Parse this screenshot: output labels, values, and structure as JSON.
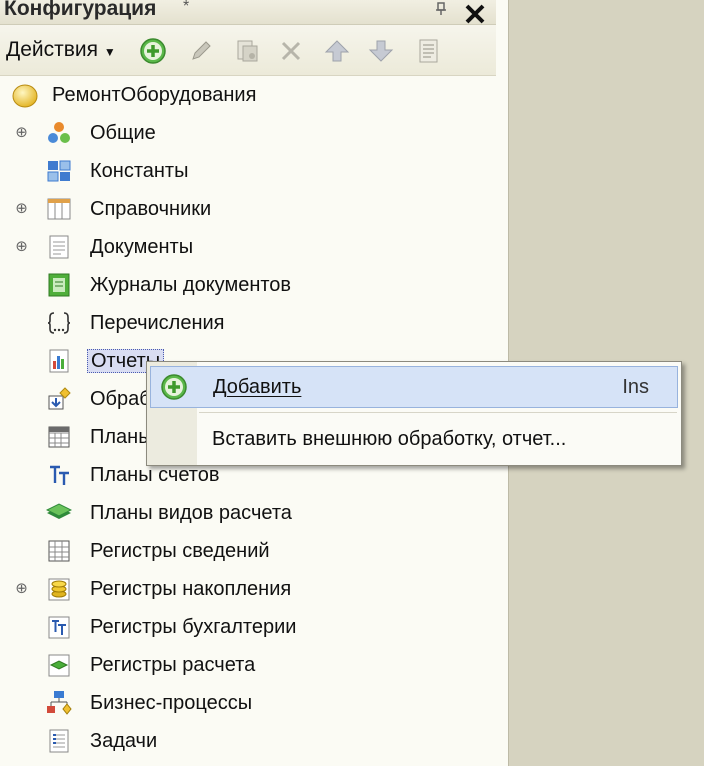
{
  "window": {
    "title": "Конфигурация",
    "title_marker": "*",
    "pin_symbol": "ª",
    "close_symbol": "✕"
  },
  "toolbar": {
    "actions_label": "Действия",
    "buttons": [
      {
        "name": "add-button",
        "icon": "plus-circle-icon"
      },
      {
        "name": "edit-button",
        "icon": "pencil-icon"
      },
      {
        "name": "copy-button",
        "icon": "copy-icon"
      },
      {
        "name": "delete-button",
        "icon": "x-icon"
      },
      {
        "name": "move-up-button",
        "icon": "arrow-up-icon"
      },
      {
        "name": "move-down-button",
        "icon": "arrow-down-icon"
      },
      {
        "name": "properties-button",
        "icon": "list-icon"
      }
    ]
  },
  "tree": {
    "items": [
      {
        "label": "РемонтОборудования",
        "icon": "root-config-icon",
        "expandable": false
      },
      {
        "label": "Общие",
        "icon": "common-icon",
        "expandable": true
      },
      {
        "label": "Константы",
        "icon": "constants-icon",
        "expandable": false
      },
      {
        "label": "Справочники",
        "icon": "catalogs-icon",
        "expandable": true
      },
      {
        "label": "Документы",
        "icon": "documents-icon",
        "expandable": true
      },
      {
        "label": "Журналы документов",
        "icon": "document-journals-icon",
        "expandable": false
      },
      {
        "label": "Перечисления",
        "icon": "enums-icon",
        "expandable": false
      },
      {
        "label": "Отчеты",
        "icon": "reports-icon",
        "expandable": false,
        "selected": true
      },
      {
        "label": "Обработки",
        "icon": "data-processors-icon",
        "expandable": false
      },
      {
        "label": "Планы видов характеристик",
        "icon": "chart-of-characteristics-icon",
        "expandable": false
      },
      {
        "label": "Планы счетов",
        "icon": "chart-of-accounts-icon",
        "expandable": false
      },
      {
        "label": "Планы видов расчета",
        "icon": "chart-of-calculation-types-icon",
        "expandable": false
      },
      {
        "label": "Регистры сведений",
        "icon": "information-registers-icon",
        "expandable": false
      },
      {
        "label": "Регистры накопления",
        "icon": "accumulation-registers-icon",
        "expandable": true
      },
      {
        "label": "Регистры бухгалтерии",
        "icon": "accounting-registers-icon",
        "expandable": false
      },
      {
        "label": "Регистры расчета",
        "icon": "calculation-registers-icon",
        "expandable": false
      },
      {
        "label": "Бизнес-процессы",
        "icon": "business-processes-icon",
        "expandable": false
      },
      {
        "label": "Задачи",
        "icon": "tasks-icon",
        "expandable": false
      }
    ]
  },
  "context_menu": {
    "items": [
      {
        "label": "Добавить",
        "shortcut": "Ins",
        "icon": "plus-circle-icon",
        "highlighted": true
      },
      {
        "label": "Вставить внешнюю обработку, отчет...",
        "shortcut": "",
        "icon": ""
      }
    ]
  },
  "colors": {
    "selection": "#d9ddf2",
    "menu_highlight": "#d6e3f7",
    "panel_bg": "#fbfbf4",
    "desktop_bg": "#d6d3c0"
  }
}
